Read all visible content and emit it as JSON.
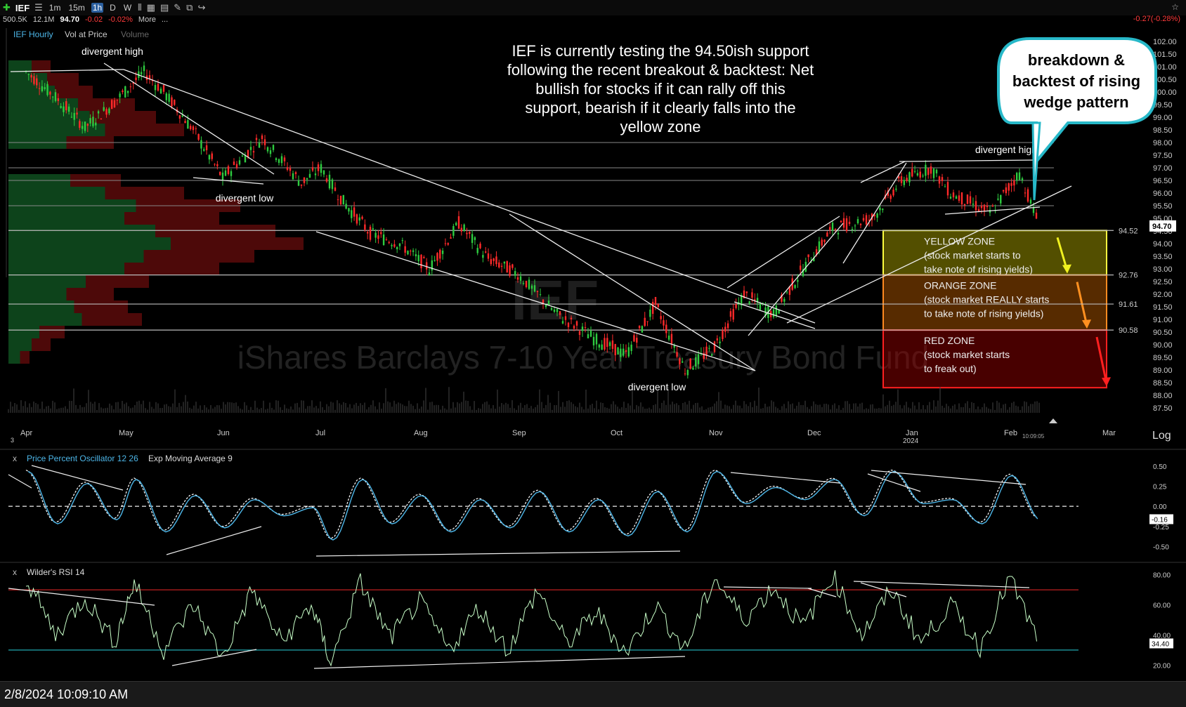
{
  "toolbar": {
    "symbol": "IEF",
    "timeframes": [
      "1m",
      "15m",
      "1h",
      "D",
      "W"
    ],
    "active_timeframe": "1h",
    "more_label": "More",
    "ellipsis": "..."
  },
  "quote": {
    "volume": "500.5K",
    "avg_volume": "12.1M",
    "price": "94.70",
    "change": "-0.02",
    "change_pct": "-0.02%",
    "top_right_change": "-0.27(-0.28%)"
  },
  "colors": {
    "background": "#000000",
    "up_candle": "#2ecc40",
    "down_candle": "#ff2a2a",
    "yellow_zone": "#b8b000",
    "orange_zone": "#c06000",
    "red_zone": "#a00000",
    "callout_border": "#27b8c8",
    "oscillator": "#4db6e8",
    "rsi_line": "#c8ffc8",
    "rsi_upper": "#c02020",
    "rsi_lower": "#20a8b0"
  },
  "chart_data": [
    {
      "type": "line",
      "panel": "price",
      "title": "IEF Hourly",
      "overlay_label": "Vol at Price",
      "volume_label": "Volume",
      "watermark_symbol": "IEF",
      "watermark_name": "iShares Barclays 7-10 Year Treasury Bond Fund",
      "x_ticks": [
        "Apr",
        "May",
        "Jun",
        "Jul",
        "Aug",
        "Sep",
        "Oct",
        "Nov",
        "Dec",
        "Jan",
        "Feb",
        "Mar"
      ],
      "x_tick_months": [
        0,
        1,
        2,
        3,
        4,
        5,
        6,
        7,
        8,
        9,
        10,
        11
      ],
      "x_start_label": "3",
      "x_year_label": "2024",
      "x_time_label": "10:09:05",
      "ylim": [
        87.25,
        102.25
      ],
      "y_ticks": [
        87.5,
        88.0,
        88.5,
        89.0,
        89.5,
        90.0,
        90.5,
        91.0,
        91.5,
        92.0,
        92.5,
        93.0,
        93.5,
        94.0,
        94.5,
        95.0,
        95.5,
        96.0,
        96.5,
        97.0,
        97.5,
        98.0,
        98.5,
        99.0,
        99.5,
        100.0,
        100.5,
        101.0,
        101.5,
        102.0
      ],
      "y_tick_labels": [
        "87.50",
        "88.00",
        "88.50",
        "89.00",
        "89.50",
        "90.00",
        "90.50",
        "91.00",
        "91.50",
        "92.00",
        "92.50",
        "93.00",
        "93.50",
        "94.00",
        "94.50",
        "95.00",
        "95.50",
        "96.00",
        "96.50",
        "97.00",
        "97.50",
        "98.00",
        "98.50",
        "99.00",
        "99.50",
        "100.00",
        "100.50",
        "101.00",
        "101.50",
        "102.00"
      ],
      "horizontal_levels": [
        {
          "value": 94.52,
          "label": "94.52"
        },
        {
          "value": 92.76,
          "label": "92.76"
        },
        {
          "value": 91.61,
          "label": "91.61"
        },
        {
          "value": 90.58,
          "label": "90.58"
        }
      ],
      "last_price": 94.7,
      "last_price_label": "94.70",
      "series": [
        {
          "x": [
            0.0,
            0.3,
            0.6,
            0.9,
            1.2,
            1.4,
            1.7,
            2.0,
            2.4,
            2.8,
            3.0,
            3.2,
            3.5,
            3.8,
            4.1,
            4.4,
            4.7,
            5.0,
            5.4,
            5.8,
            6.1,
            6.4,
            6.7,
            7.0,
            7.3,
            7.6,
            7.9,
            8.2,
            8.6,
            8.9,
            9.2,
            9.4,
            9.8,
            10.1,
            10.3
          ],
          "y": [
            100.8,
            99.8,
            98.6,
            99.6,
            100.8,
            100.0,
            98.5,
            96.6,
            98.2,
            96.4,
            97.0,
            95.8,
            94.4,
            94.0,
            93.0,
            94.8,
            93.4,
            92.8,
            91.2,
            90.2,
            89.6,
            91.6,
            89.0,
            89.9,
            92.0,
            91.2,
            93.0,
            94.6,
            95.0,
            96.5,
            97.0,
            96.0,
            95.2,
            96.8,
            94.7
          ]
        }
      ],
      "annotations": {
        "main_text": "IEF is currently testing the 94.50ish support following the recent breakout & backtest: Net bullish for stocks if it can rally off this support, bearish if it clearly falls into the yellow zone",
        "callout": "breakdown & backtest of rising wedge pattern",
        "divergent_high_1": "divergent high",
        "divergent_low_1": "divergent low",
        "divergent_low_2": "divergent low",
        "divergent_high_2": "divergent high",
        "zones": [
          {
            "name": "YELLOW ZONE",
            "desc1": "(stock market starts to",
            "desc2": "take note of rising yields)",
            "top": 94.52,
            "bottom": 92.76
          },
          {
            "name": "ORANGE ZONE",
            "desc1": "(stock market REALLY starts",
            "desc2": "to take note of rising yields)",
            "top": 92.76,
            "bottom": 90.58
          },
          {
            "name": "RED ZONE",
            "desc1": "(stock market starts",
            "desc2": "to freak out)",
            "top": 90.58,
            "bottom": 88.3
          }
        ]
      }
    },
    {
      "type": "line",
      "panel": "ppo",
      "title": "Price Percent Oscillator 12 26",
      "signal_label": "Exp Moving Average 9",
      "ylim": [
        -0.6,
        0.62
      ],
      "y_ticks": [
        0.5,
        0.25,
        0.0,
        -0.25,
        -0.5
      ],
      "y_tick_labels": [
        "0.50",
        "0.25",
        "0.00",
        "-0.25",
        "-0.50"
      ],
      "last_value": -0.16,
      "last_value_label": "-0.16",
      "series": [
        {
          "x": [
            0.0,
            0.3,
            0.6,
            0.9,
            1.1,
            1.4,
            1.7,
            2.0,
            2.3,
            2.6,
            2.9,
            3.1,
            3.4,
            3.7,
            4.0,
            4.3,
            4.6,
            4.9,
            5.2,
            5.5,
            5.8,
            6.1,
            6.4,
            6.7,
            7.0,
            7.3,
            7.6,
            7.9,
            8.2,
            8.5,
            8.8,
            9.1,
            9.4,
            9.7,
            10.0,
            10.3
          ],
          "y": [
            0.45,
            -0.2,
            0.3,
            -0.15,
            0.35,
            -0.3,
            0.15,
            -0.25,
            0.1,
            -0.1,
            0.0,
            -0.4,
            0.35,
            -0.2,
            0.15,
            -0.3,
            0.1,
            -0.25,
            0.2,
            -0.3,
            0.1,
            -0.35,
            0.2,
            -0.3,
            0.45,
            0.05,
            0.25,
            0.1,
            0.35,
            -0.1,
            0.45,
            0.05,
            0.1,
            -0.2,
            0.4,
            -0.16
          ]
        }
      ]
    },
    {
      "type": "line",
      "panel": "rsi",
      "title": "Wilder's RSI 14",
      "ylim": [
        15,
        85
      ],
      "y_ticks": [
        80,
        60,
        40,
        20
      ],
      "y_tick_labels": [
        "80.00",
        "60.00",
        "40.00",
        "20.00"
      ],
      "upper_level": 70,
      "lower_level": 30,
      "last_value": 34.4,
      "last_value_label": "34.40",
      "series": [
        {
          "x": [
            0.0,
            0.3,
            0.6,
            0.9,
            1.1,
            1.4,
            1.7,
            2.0,
            2.3,
            2.6,
            2.9,
            3.1,
            3.4,
            3.7,
            4.0,
            4.3,
            4.6,
            4.9,
            5.2,
            5.5,
            5.8,
            6.1,
            6.4,
            6.7,
            7.0,
            7.3,
            7.6,
            7.9,
            8.2,
            8.5,
            8.8,
            9.1,
            9.4,
            9.7,
            10.0,
            10.3
          ],
          "y": [
            78,
            40,
            65,
            35,
            75,
            30,
            60,
            25,
            70,
            35,
            60,
            22,
            75,
            38,
            62,
            30,
            58,
            30,
            70,
            34,
            55,
            28,
            60,
            30,
            78,
            50,
            72,
            45,
            80,
            40,
            70,
            35,
            60,
            32,
            78,
            34.4
          ]
        }
      ]
    }
  ],
  "status": {
    "timestamp": "2/8/2024 10:09:10 AM"
  },
  "log_label": "Log"
}
